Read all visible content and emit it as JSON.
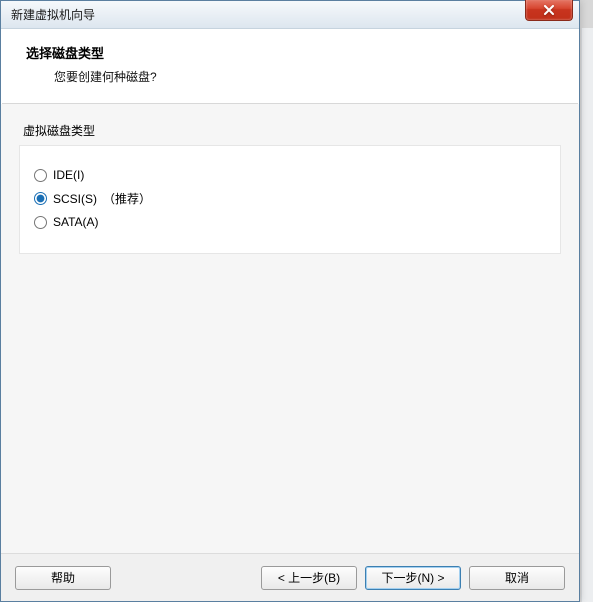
{
  "window": {
    "title": "新建虚拟机向导"
  },
  "header": {
    "title": "选择磁盘类型",
    "subtitle": "您要创建何种磁盘?"
  },
  "group": {
    "label": "虚拟磁盘类型",
    "options": {
      "ide": {
        "label": "IDE(I)",
        "suffix": ""
      },
      "scsi": {
        "label": "SCSI(S)",
        "suffix": "（推荐）"
      },
      "sata": {
        "label": "SATA(A)",
        "suffix": ""
      }
    },
    "selected": "scsi"
  },
  "footer": {
    "help": "帮助",
    "back": "< 上一步(B)",
    "next": "下一步(N) >",
    "cancel": "取消"
  }
}
